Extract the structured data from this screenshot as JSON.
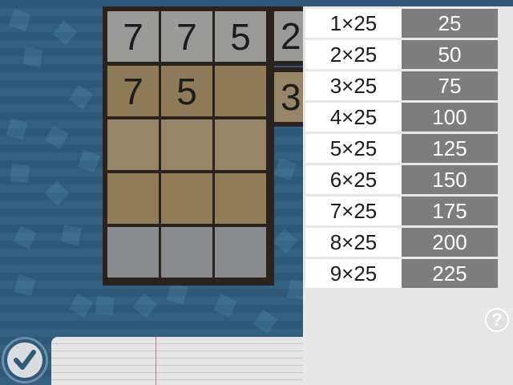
{
  "board": {
    "rows": [
      [
        "7",
        "7",
        "5"
      ],
      [
        "7",
        "5",
        ""
      ],
      [
        "",
        "",
        ""
      ],
      [
        "",
        "",
        ""
      ],
      [
        "",
        "",
        ""
      ]
    ],
    "side_tiles": [
      "2",
      "3"
    ]
  },
  "multiplication_table": {
    "rows": [
      {
        "expr": "1×25",
        "result": "25"
      },
      {
        "expr": "2×25",
        "result": "50"
      },
      {
        "expr": "3×25",
        "result": "75"
      },
      {
        "expr": "4×25",
        "result": "100"
      },
      {
        "expr": "5×25",
        "result": "125"
      },
      {
        "expr": "6×25",
        "result": "150"
      },
      {
        "expr": "7×25",
        "result": "175"
      },
      {
        "expr": "8×25",
        "result": "200"
      },
      {
        "expr": "9×25",
        "result": "225"
      }
    ]
  },
  "help": {
    "label": "?"
  },
  "icons": {
    "check": "check-icon",
    "help": "help-icon"
  },
  "colors": {
    "background": "#2f5a7a",
    "tile_gray": "#9a9a98",
    "tile_tan": "#8f7b58",
    "result_cell": "#7d7d7d"
  }
}
